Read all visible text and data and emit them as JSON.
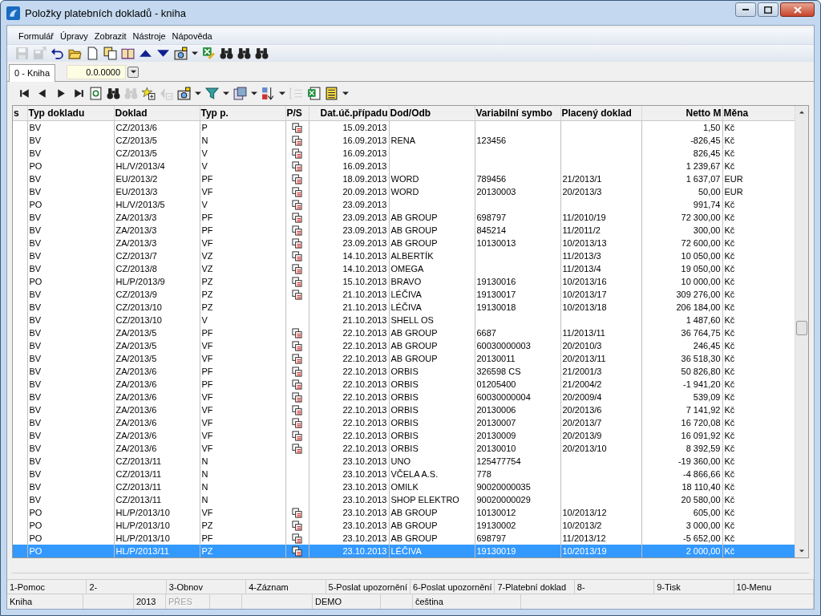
{
  "window": {
    "title": "Položky platebních dokladů - kniha"
  },
  "menu": [
    "Formulář",
    "Úpravy",
    "Zobrazit",
    "Nástroje",
    "Nápověda"
  ],
  "toolbar": [
    {
      "kind": "save",
      "disabled": true
    },
    {
      "kind": "save-as",
      "disabled": true
    },
    {
      "kind": "undo",
      "disabled": false
    },
    {
      "kind": "open",
      "disabled": false
    },
    {
      "kind": "new",
      "disabled": false
    },
    {
      "kind": "copy",
      "disabled": false
    },
    {
      "kind": "book",
      "disabled": false
    },
    {
      "kind": "up",
      "disabled": false
    },
    {
      "kind": "down",
      "disabled": false
    },
    {
      "kind": "camera",
      "disabled": false
    },
    {
      "kind": "caret",
      "disabled": false
    },
    {
      "kind": "excel-pen",
      "disabled": false
    },
    {
      "kind": "binoculars",
      "disabled": false
    },
    {
      "kind": "binoculars",
      "disabled": false
    },
    {
      "kind": "binoculars",
      "disabled": false
    }
  ],
  "tabs": [
    {
      "label": "0 - Kniha",
      "selected": true
    }
  ],
  "period_field": {
    "value": "0.0.0000"
  },
  "grid_toolbar": [
    {
      "kind": "first",
      "disabled": false
    },
    {
      "kind": "prev",
      "disabled": false
    },
    {
      "kind": "next",
      "disabled": false
    },
    {
      "kind": "last",
      "disabled": false
    },
    {
      "kind": "refresh",
      "disabled": false
    },
    {
      "kind": "binoculars",
      "disabled": false
    },
    {
      "kind": "binoculars",
      "disabled": true
    },
    {
      "kind": "star-add",
      "disabled": false
    },
    {
      "kind": "remove",
      "disabled": true
    },
    {
      "kind": "camera",
      "disabled": false
    },
    {
      "kind": "caret",
      "disabled": false
    },
    {
      "kind": "filter",
      "disabled": false
    },
    {
      "kind": "caret",
      "disabled": false
    },
    {
      "kind": "columns",
      "disabled": false
    },
    {
      "kind": "caret",
      "disabled": false
    },
    {
      "kind": "sort",
      "disabled": false
    },
    {
      "kind": "caret",
      "disabled": false
    },
    {
      "kind": "list",
      "disabled": true
    },
    {
      "kind": "excel",
      "disabled": false
    },
    {
      "kind": "table",
      "disabled": false
    },
    {
      "kind": "caret",
      "disabled": false
    }
  ],
  "table": {
    "columns": [
      "s",
      "Typ dokladu",
      "Doklad",
      "Typ p.",
      "P/S",
      "Dat.úč.případu",
      "Dod/Odb",
      "Variabilní symbo",
      "Placený doklad",
      "Netto M",
      "Měna"
    ],
    "rows": [
      {
        "typ_dokladu": "BV",
        "doklad": "CZ/2013/6",
        "typ_p": "P",
        "ps": true,
        "datum": "15.09.2013",
        "netto": "1,50",
        "mena": "Kč",
        "selected": false
      },
      {
        "typ_dokladu": "BV",
        "doklad": "CZ/2013/5",
        "typ_p": "N",
        "ps": true,
        "datum": "16.09.2013",
        "dod_odb": "RENA",
        "variabilni_symbol": "123456",
        "netto": "-826,45",
        "mena": "Kč",
        "selected": false
      },
      {
        "typ_dokladu": "BV",
        "doklad": "CZ/2013/5",
        "typ_p": "V",
        "ps": true,
        "datum": "16.09.2013",
        "netto": "826,45",
        "mena": "Kč",
        "selected": false
      },
      {
        "typ_dokladu": "PO",
        "doklad": "HL/V/2013/4",
        "typ_p": "V",
        "ps": true,
        "datum": "16.09.2013",
        "netto": "1 239,67",
        "mena": "Kč",
        "selected": false
      },
      {
        "typ_dokladu": "BV",
        "doklad": "EU/2013/2",
        "typ_p": "PF",
        "ps": true,
        "datum": "18.09.2013",
        "dod_odb": "WORD",
        "variabilni_symbol": "789456",
        "placeny_doklad": "21/2013/1",
        "netto": "1 637,07",
        "mena": "EUR",
        "selected": false
      },
      {
        "typ_dokladu": "BV",
        "doklad": "EU/2013/3",
        "typ_p": "VF",
        "ps": true,
        "datum": "20.09.2013",
        "dod_odb": "WORD",
        "variabilni_symbol": "20130003",
        "placeny_doklad": "20/2013/3",
        "netto": "50,00",
        "mena": "EUR",
        "selected": false
      },
      {
        "typ_dokladu": "PO",
        "doklad": "HL/V/2013/5",
        "typ_p": "V",
        "ps": true,
        "datum": "23.09.2013",
        "netto": "991,74",
        "mena": "Kč",
        "selected": false
      },
      {
        "typ_dokladu": "BV",
        "doklad": "ZA/2013/3",
        "typ_p": "PF",
        "ps": true,
        "datum": "23.09.2013",
        "dod_odb": "AB GROUP",
        "variabilni_symbol": "698797",
        "placeny_doklad": "11/2010/19",
        "netto": "72 300,00",
        "mena": "Kč",
        "selected": false
      },
      {
        "typ_dokladu": "BV",
        "doklad": "ZA/2013/3",
        "typ_p": "PF",
        "ps": true,
        "datum": "23.09.2013",
        "dod_odb": "AB GROUP",
        "variabilni_symbol": "845214",
        "placeny_doklad": "11/2011/2",
        "netto": "300,00",
        "mena": "Kč",
        "selected": false
      },
      {
        "typ_dokladu": "BV",
        "doklad": "ZA/2013/3",
        "typ_p": "VF",
        "ps": true,
        "datum": "23.09.2013",
        "dod_odb": "AB GROUP",
        "variabilni_symbol": "10130013",
        "placeny_doklad": "10/2013/13",
        "netto": "72 600,00",
        "mena": "Kč",
        "selected": false
      },
      {
        "typ_dokladu": "BV",
        "doklad": "CZ/2013/7",
        "typ_p": "VZ",
        "ps": true,
        "datum": "14.10.2013",
        "dod_odb": "ALBERTÍK",
        "placeny_doklad": "11/2013/3",
        "netto": "10 050,00",
        "mena": "Kč",
        "selected": false
      },
      {
        "typ_dokladu": "BV",
        "doklad": "CZ/2013/8",
        "typ_p": "VZ",
        "ps": true,
        "datum": "14.10.2013",
        "dod_odb": "OMEGA",
        "placeny_doklad": "11/2013/4",
        "netto": "19 050,00",
        "mena": "Kč",
        "selected": false
      },
      {
        "typ_dokladu": "PO",
        "doklad": "HL/P/2013/9",
        "typ_p": "PZ",
        "ps": true,
        "datum": "15.10.2013",
        "dod_odb": "BRAVO",
        "variabilni_symbol": "19130016",
        "placeny_doklad": "10/2013/16",
        "netto": "10 000,00",
        "mena": "Kč",
        "selected": false
      },
      {
        "typ_dokladu": "BV",
        "doklad": "CZ/2013/9",
        "typ_p": "PZ",
        "ps": true,
        "datum": "21.10.2013",
        "dod_odb": "LÉČIVA",
        "variabilni_symbol": "19130017",
        "placeny_doklad": "10/2013/17",
        "netto": "309 276,00",
        "mena": "Kč",
        "selected": false
      },
      {
        "typ_dokladu": "BV",
        "doklad": "CZ/2013/10",
        "typ_p": "PZ",
        "ps": false,
        "datum": "21.10.2013",
        "dod_odb": "LÉČIVA",
        "variabilni_symbol": "19130018",
        "placeny_doklad": "10/2013/18",
        "netto": "206 184,00",
        "mena": "Kč",
        "selected": false
      },
      {
        "typ_dokladu": "BV",
        "doklad": "CZ/2013/10",
        "typ_p": "V",
        "ps": false,
        "datum": "21.10.2013",
        "dod_odb": "SHELL OS",
        "netto": "1 487,60",
        "mena": "Kč",
        "selected": false
      },
      {
        "typ_dokladu": "BV",
        "doklad": "ZA/2013/5",
        "typ_p": "PF",
        "ps": true,
        "datum": "22.10.2013",
        "dod_odb": "AB GROUP",
        "variabilni_symbol": "6687",
        "placeny_doklad": "11/2013/11",
        "netto": "36 764,75",
        "mena": "Kč",
        "selected": false
      },
      {
        "typ_dokladu": "BV",
        "doklad": "ZA/2013/5",
        "typ_p": "VF",
        "ps": true,
        "datum": "22.10.2013",
        "dod_odb": "AB GROUP",
        "variabilni_symbol": "60030000003",
        "placeny_doklad": "20/2010/3",
        "netto": "246,45",
        "mena": "Kč",
        "selected": false
      },
      {
        "typ_dokladu": "BV",
        "doklad": "ZA/2013/5",
        "typ_p": "VF",
        "ps": true,
        "datum": "22.10.2013",
        "dod_odb": "AB GROUP",
        "variabilni_symbol": "20130011",
        "placeny_doklad": "20/2013/11",
        "netto": "36 518,30",
        "mena": "Kč",
        "selected": false
      },
      {
        "typ_dokladu": "BV",
        "doklad": "ZA/2013/6",
        "typ_p": "PF",
        "ps": true,
        "datum": "22.10.2013",
        "dod_odb": "ORBIS",
        "variabilni_symbol": "326598 CS",
        "placeny_doklad": "21/2001/3",
        "netto": "50 826,80",
        "mena": "Kč",
        "selected": false
      },
      {
        "typ_dokladu": "BV",
        "doklad": "ZA/2013/6",
        "typ_p": "PF",
        "ps": true,
        "datum": "22.10.2013",
        "dod_odb": "ORBIS",
        "variabilni_symbol": "01205400",
        "placeny_doklad": "21/2004/2",
        "netto": "-1 941,20",
        "mena": "Kč",
        "selected": false
      },
      {
        "typ_dokladu": "BV",
        "doklad": "ZA/2013/6",
        "typ_p": "VF",
        "ps": true,
        "datum": "22.10.2013",
        "dod_odb": "ORBIS",
        "variabilni_symbol": "60030000004",
        "placeny_doklad": "20/2009/4",
        "netto": "539,09",
        "mena": "Kč",
        "selected": false
      },
      {
        "typ_dokladu": "BV",
        "doklad": "ZA/2013/6",
        "typ_p": "VF",
        "ps": true,
        "datum": "22.10.2013",
        "dod_odb": "ORBIS",
        "variabilni_symbol": "20130006",
        "placeny_doklad": "20/2013/6",
        "netto": "7 141,92",
        "mena": "Kč",
        "selected": false
      },
      {
        "typ_dokladu": "BV",
        "doklad": "ZA/2013/6",
        "typ_p": "VF",
        "ps": true,
        "datum": "22.10.2013",
        "dod_odb": "ORBIS",
        "variabilni_symbol": "20130007",
        "placeny_doklad": "20/2013/7",
        "netto": "16 720,08",
        "mena": "Kč",
        "selected": false
      },
      {
        "typ_dokladu": "BV",
        "doklad": "ZA/2013/6",
        "typ_p": "VF",
        "ps": true,
        "datum": "22.10.2013",
        "dod_odb": "ORBIS",
        "variabilni_symbol": "20130009",
        "placeny_doklad": "20/2013/9",
        "netto": "16 091,92",
        "mena": "Kč",
        "selected": false
      },
      {
        "typ_dokladu": "BV",
        "doklad": "ZA/2013/6",
        "typ_p": "VF",
        "ps": true,
        "datum": "22.10.2013",
        "dod_odb": "ORBIS",
        "variabilni_symbol": "20130010",
        "placeny_doklad": "20/2013/10",
        "netto": "8 392,59",
        "mena": "Kč",
        "selected": false
      },
      {
        "typ_dokladu": "BV",
        "doklad": "CZ/2013/11",
        "typ_p": "N",
        "ps": false,
        "datum": "23.10.2013",
        "dod_odb": "UNO",
        "variabilni_symbol": "125477754",
        "netto": "-19 360,00",
        "mena": "Kč",
        "selected": false
      },
      {
        "typ_dokladu": "BV",
        "doklad": "CZ/2013/11",
        "typ_p": "N",
        "ps": false,
        "datum": "23.10.2013",
        "dod_odb": "VČELA A.S.",
        "variabilni_symbol": "778",
        "netto": "-4 866,66",
        "mena": "Kč",
        "selected": false
      },
      {
        "typ_dokladu": "BV",
        "doklad": "CZ/2013/11",
        "typ_p": "N",
        "ps": false,
        "datum": "23.10.2013",
        "dod_odb": "OMILK",
        "variabilni_symbol": "90020000035",
        "netto": "18 110,40",
        "mena": "Kč",
        "selected": false
      },
      {
        "typ_dokladu": "BV",
        "doklad": "CZ/2013/11",
        "typ_p": "N",
        "ps": false,
        "datum": "23.10.2013",
        "dod_odb": "SHOP ELEKTRO",
        "variabilni_symbol": "90020000029",
        "netto": "20 580,00",
        "mena": "Kč",
        "selected": false
      },
      {
        "typ_dokladu": "PO",
        "doklad": "HL/P/2013/10",
        "typ_p": "VF",
        "ps": true,
        "datum": "23.10.2013",
        "dod_odb": "AB GROUP",
        "variabilni_symbol": "10130012",
        "placeny_doklad": "10/2013/12",
        "netto": "605,00",
        "mena": "Kč",
        "selected": false
      },
      {
        "typ_dokladu": "PO",
        "doklad": "HL/P/2013/10",
        "typ_p": "PZ",
        "ps": true,
        "datum": "23.10.2013",
        "dod_odb": "AB GROUP",
        "variabilni_symbol": "19130002",
        "placeny_doklad": "10/2013/2",
        "netto": "3 000,00",
        "mena": "Kč",
        "selected": false
      },
      {
        "typ_dokladu": "PO",
        "doklad": "HL/P/2013/10",
        "typ_p": "PF",
        "ps": true,
        "datum": "23.10.2013",
        "dod_odb": "AB GROUP",
        "variabilni_symbol": "698797",
        "placeny_doklad": "11/2013/12",
        "netto": "-5 652,00",
        "mena": "Kč",
        "selected": false
      },
      {
        "typ_dokladu": "PO",
        "doklad": "HL/P/2013/11",
        "typ_p": "PZ",
        "ps": true,
        "datum": "23.10.2013",
        "dod_odb": "LÉČIVA",
        "variabilni_symbol": "19130019",
        "placeny_doklad": "10/2013/19",
        "netto": "2 000,00",
        "mena": "Kč",
        "selected": true
      }
    ]
  },
  "function_keys": [
    "1-Pomoc",
    "2-",
    "3-Obnov",
    "4-Záznam",
    "5-Poslat upozornění",
    "6-Poslat upozornění",
    "7-Platební doklad",
    "8-",
    "9-Tisk",
    "10-Menu"
  ],
  "status_bar": [
    {
      "text": "Kniha",
      "disabled": false
    },
    {
      "text": "2013",
      "disabled": false
    },
    {
      "text": "PŘES",
      "disabled": true
    },
    {
      "text": "DEMO",
      "disabled": false
    },
    {
      "text": "čeština",
      "disabled": false
    }
  ]
}
